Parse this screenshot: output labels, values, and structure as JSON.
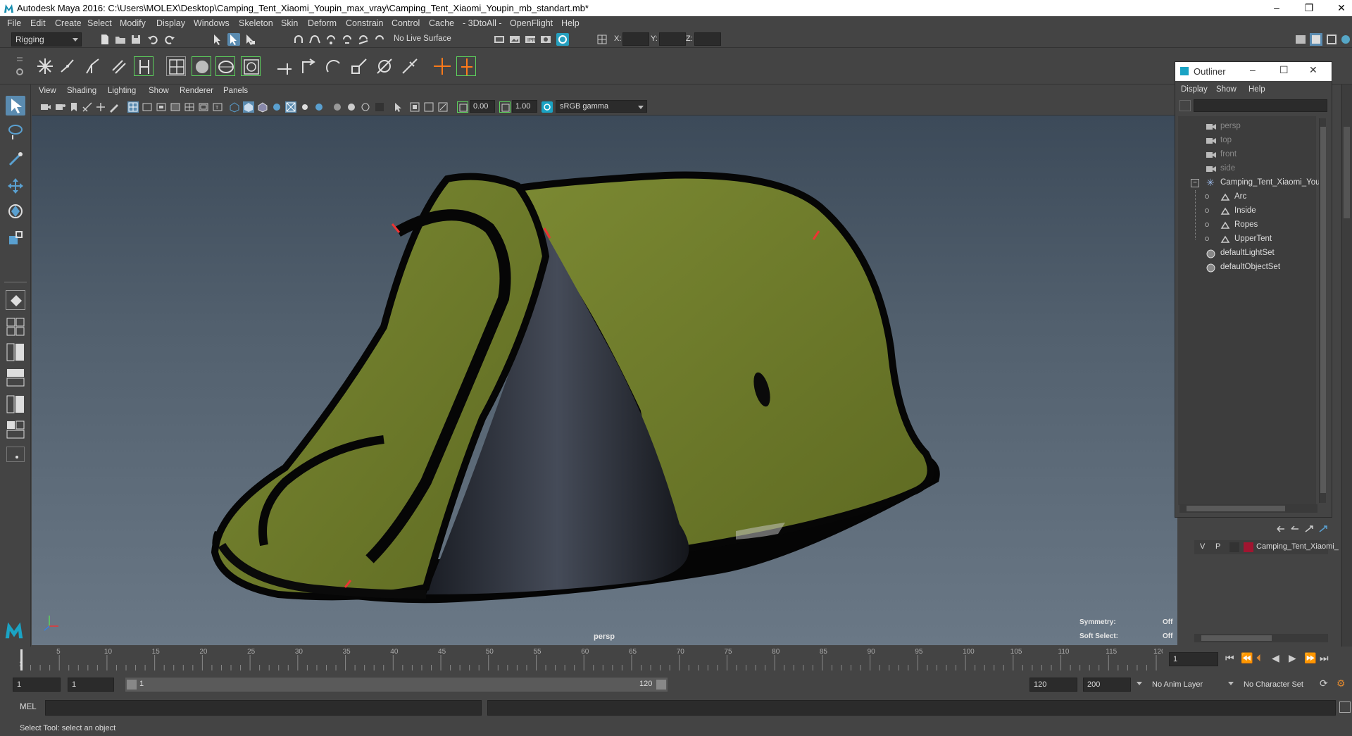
{
  "window": {
    "title": "Autodesk Maya 2016: C:\\Users\\MOLEX\\Desktop\\Camping_Tent_Xiaomi_Youpin_max_vray\\Camping_Tent_Xiaomi_Youpin_mb_standart.mb*",
    "minimize": "–",
    "restore": "❐",
    "close": "✕"
  },
  "menubar": [
    "File",
    "Edit",
    "Create",
    "Select",
    "Modify",
    "Display",
    "Windows",
    "Skeleton",
    "Skin",
    "Deform",
    "Constrain",
    "Control",
    "Cache",
    "- 3DtoAll -",
    "OpenFlight",
    "Help"
  ],
  "statusline": {
    "menuset": "Rigging",
    "live_surface": "No Live Surface",
    "x_label": "X:",
    "y_label": "Y:",
    "z_label": "Z:"
  },
  "panel": {
    "menus": [
      "View",
      "Shading",
      "Lighting",
      "Show",
      "Renderer",
      "Panels"
    ],
    "exposure": "0.00",
    "gamma": "1.00",
    "colorspace": "sRGB gamma"
  },
  "viewport": {
    "camera": "persp",
    "symmetry_label": "Symmetry:",
    "symmetry_value": "Off",
    "softselect_label": "Soft Select:",
    "softselect_value": "Off"
  },
  "outliner": {
    "title": "Outliner",
    "menus": [
      "Display",
      "Show",
      "Help"
    ],
    "items": [
      {
        "label": "persp",
        "kind": "camera",
        "indent": 0
      },
      {
        "label": "top",
        "kind": "camera",
        "indent": 0
      },
      {
        "label": "front",
        "kind": "camera",
        "indent": 0
      },
      {
        "label": "side",
        "kind": "camera",
        "indent": 0
      },
      {
        "label": "Camping_Tent_Xiaomi_Youp",
        "kind": "group",
        "indent": 0
      },
      {
        "label": "Arc",
        "kind": "mesh",
        "indent": 1
      },
      {
        "label": "Inside",
        "kind": "mesh",
        "indent": 1
      },
      {
        "label": "Ropes",
        "kind": "mesh",
        "indent": 1
      },
      {
        "label": "UpperTent",
        "kind": "mesh",
        "indent": 1
      },
      {
        "label": "defaultLightSet",
        "kind": "set",
        "indent": 0
      },
      {
        "label": "defaultObjectSet",
        "kind": "set",
        "indent": 0
      }
    ]
  },
  "layers": {
    "v": "V",
    "p": "P",
    "name": "Camping_Tent_Xiaomi_",
    "color": "#a01530"
  },
  "timeline": {
    "ticks": [
      "5",
      "10",
      "15",
      "20",
      "25",
      "30",
      "35",
      "40",
      "45",
      "50",
      "55",
      "60",
      "65",
      "70",
      "75",
      "80",
      "85",
      "90",
      "95",
      "100",
      "105",
      "110",
      "115",
      "120"
    ],
    "first_tick": "1",
    "current_frame": "1",
    "range_start": "1",
    "range_inner_start": "1",
    "range_bar_start": "1",
    "range_bar_end": "120",
    "range_end": "120",
    "anim_end": "200",
    "anim_layer": "No Anim Layer",
    "character_set": "No Character Set"
  },
  "cmd": {
    "mel": "MEL",
    "help": "Select Tool: select an object"
  },
  "colors": {
    "accent": "#56a7c7",
    "tent_green": "#6e7a2c",
    "layer_red": "#a01530"
  }
}
